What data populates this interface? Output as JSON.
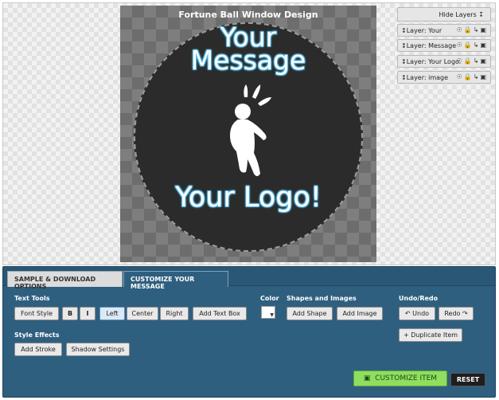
{
  "canvas": {
    "title": "Fortune Ball Window Design",
    "message_line1": "Your",
    "message_line2": "Message",
    "logo_text": "Your Logo!"
  },
  "layers": {
    "hide_label": "Hide Layers",
    "hide_icon": "pin-icon",
    "items": [
      {
        "label": "↕Layer: Your"
      },
      {
        "label": "↕Layer: Message"
      },
      {
        "label": "↕Layer: Your Logo."
      },
      {
        "label": "↕Layer: image"
      }
    ],
    "item_icons": [
      "bulb-icon",
      "lock-icon",
      "arrow-icon",
      "trash-icon"
    ]
  },
  "tabs": {
    "sample": "SAMPLE & DOWNLOAD OPTIONS",
    "customize": "CUSTOMIZE YOUR MESSAGE"
  },
  "text_tools": {
    "label": "Text Tools",
    "font_style": "Font Style",
    "bold": "B",
    "italic": "I",
    "left": "Left",
    "center": "Center",
    "right": "Right",
    "add_text_box": "Add Text Box"
  },
  "color": {
    "label": "Color",
    "value": "#ffffff"
  },
  "shapes": {
    "label": "Shapes and Images",
    "add_shape": "Add Shape",
    "add_image": "Add Image"
  },
  "undo_redo": {
    "label": "Undo/Redo",
    "undo": "Undo",
    "redo": "Redo",
    "duplicate": "Duplicate Item"
  },
  "style_effects": {
    "label": "Style Effects",
    "add_stroke": "Add Stroke",
    "shadow_settings": "Shadow Settings"
  },
  "actions": {
    "customize_item": "CUSTOMIZE ITEM",
    "reset": "RESET"
  },
  "colors": {
    "panel": "#2f5f7f",
    "customize_green": "#8fde5f",
    "ball": "#2b2b2b",
    "text_glow": "#5fc0e8"
  }
}
